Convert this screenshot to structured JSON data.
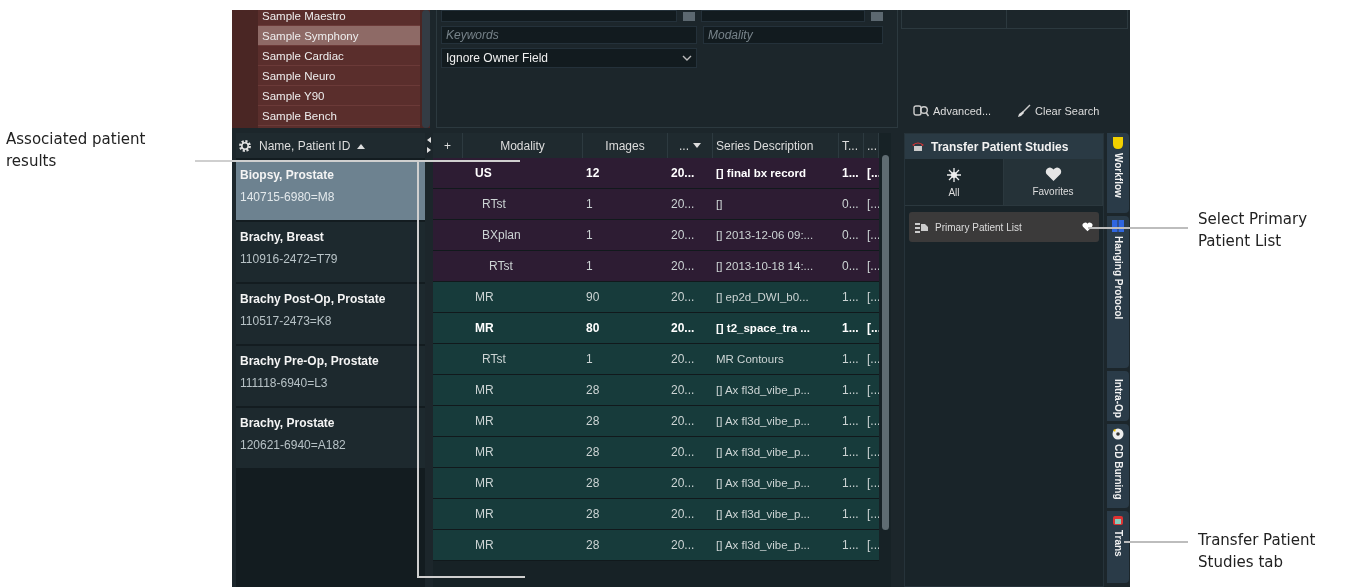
{
  "sample_lists": [
    {
      "label": "Sample Maestro",
      "selected": false
    },
    {
      "label": "Sample Symphony",
      "selected": true
    },
    {
      "label": "Sample Cardiac",
      "selected": false
    },
    {
      "label": "Sample Neuro",
      "selected": false
    },
    {
      "label": "Sample Y90",
      "selected": false
    },
    {
      "label": "Sample Bench",
      "selected": false
    }
  ],
  "search": {
    "keywords": {
      "placeholder": "Keywords"
    },
    "modality": {
      "placeholder": "Modality"
    },
    "owner": {
      "value": "Ignore Owner Field"
    },
    "actions": [
      {
        "kind": "advanced",
        "label": "Advanced..."
      },
      {
        "kind": "clear",
        "label": "Clear Search"
      }
    ]
  },
  "patient_list": {
    "header": "Name, Patient ID",
    "patients": [
      {
        "name": "Biopsy, Prostate",
        "id": "140715-6980=M8",
        "selected": true
      },
      {
        "name": "Brachy, Breast",
        "id": "110916-2472=T79",
        "selected": false
      },
      {
        "name": "Brachy Post-Op, Prostate",
        "id": "110517-2473=K8",
        "selected": false
      },
      {
        "name": "Brachy Pre-Op, Prostate",
        "id": "111118-6940=L3",
        "selected": false
      },
      {
        "name": "Brachy, Prostate",
        "id": "120621-6940=A182",
        "selected": false
      }
    ]
  },
  "series_table": {
    "columns": [
      "+",
      "Modality",
      "Images",
      "...",
      "Series Description",
      "T...",
      "..."
    ],
    "rows": [
      {
        "modality": "US",
        "images": "12",
        "column_3": "20...",
        "description": "[] final bx record",
        "column_5": "1...",
        "column_6": "[...",
        "bold": true,
        "color": "#2d1c33",
        "children": [
          {
            "modality": "RTst",
            "images": "1",
            "column_3": "20...",
            "description": "[]",
            "column_5": "0...",
            "column_6": "[...",
            "bold": false,
            "color": "#2d1c33"
          },
          {
            "modality": "BXplan",
            "images": "1",
            "column_3": "20...",
            "description": "[] 2013-12-06 09:...",
            "column_5": "0...",
            "column_6": "[...",
            "bold": false,
            "color": "#2d1c33",
            "children": [
              {
                "modality": "RTst",
                "images": "1",
                "column_3": "20...",
                "description": "[] 2013-10-18 14:...",
                "column_5": "0...",
                "column_6": "[...",
                "bold": false,
                "color": "#2d1c33"
              }
            ]
          }
        ]
      },
      {
        "modality": "MR",
        "images": "90",
        "column_3": "20...",
        "description": "[] ep2d_DWI_b0...",
        "column_5": "1...",
        "column_6": "[...",
        "bold": false,
        "color": "#173b3b"
      },
      {
        "modality": "MR",
        "images": "80",
        "column_3": "20...",
        "description": "[] t2_space_tra ...",
        "column_5": "1...",
        "column_6": "[...",
        "bold": true,
        "color": "#173b3b",
        "children": [
          {
            "modality": "RTst",
            "images": "1",
            "column_3": "20...",
            "description": "MR Contours",
            "column_5": "1...",
            "column_6": "[...",
            "bold": false,
            "color": "#173b3b"
          }
        ]
      },
      {
        "modality": "MR",
        "images": "28",
        "column_3": "20...",
        "description": "[] Ax fl3d_vibe_p...",
        "column_5": "1...",
        "column_6": "[...",
        "bold": false,
        "color": "#173b3b"
      },
      {
        "modality": "MR",
        "images": "28",
        "column_3": "20...",
        "description": "[] Ax fl3d_vibe_p...",
        "column_5": "1...",
        "column_6": "[...",
        "bold": false,
        "color": "#173b3b"
      },
      {
        "modality": "MR",
        "images": "28",
        "column_3": "20...",
        "description": "[] Ax fl3d_vibe_p...",
        "column_5": "1...",
        "column_6": "[...",
        "bold": false,
        "color": "#173b3b"
      },
      {
        "modality": "MR",
        "images": "28",
        "column_3": "20...",
        "description": "[] Ax fl3d_vibe_p...",
        "column_5": "1...",
        "column_6": "[...",
        "bold": false,
        "color": "#173b3b"
      },
      {
        "modality": "MR",
        "images": "28",
        "column_3": "20...",
        "description": "[] Ax fl3d_vibe_p...",
        "column_5": "1...",
        "column_6": "[...",
        "bold": false,
        "color": "#173b3b"
      },
      {
        "modality": "MR",
        "images": "28",
        "column_3": "20...",
        "description": "[] Ax fl3d_vibe_p...",
        "column_5": "1...",
        "column_6": "[...",
        "bold": false,
        "color": "#173b3b"
      }
    ]
  },
  "transfer_panel": {
    "title": "Transfer Patient Studies",
    "filters": [
      {
        "kind": "all",
        "label": "All",
        "selected": false
      },
      {
        "kind": "favorites",
        "label": "Favorites",
        "selected": true
      }
    ],
    "lists": [
      {
        "label": "Primary Patient List",
        "favorite": true
      }
    ]
  },
  "side_tabs": [
    {
      "kind": "workflow",
      "label": "Workflow"
    },
    {
      "kind": "hanging",
      "label": "Hanging Protocol"
    },
    {
      "kind": "intraop",
      "label": "Intra-Op"
    },
    {
      "kind": "cd",
      "label": "CD Burning"
    },
    {
      "kind": "transfer",
      "label": "Trans"
    }
  ],
  "left_callouts": [
    "Associated patient results"
  ],
  "right_callouts": [
    "Select Primary Patient List",
    "Transfer Patient Studies tab"
  ]
}
